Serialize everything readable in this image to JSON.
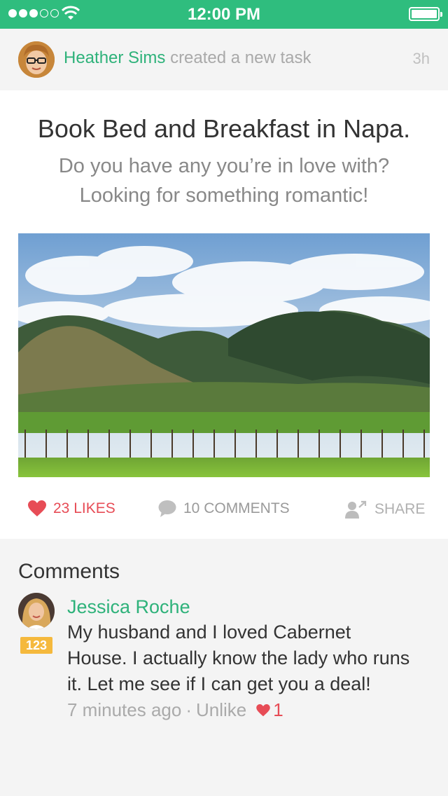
{
  "status_bar": {
    "time": "12:00 PM",
    "signal_bars_filled": 3,
    "signal_bars_total": 5
  },
  "activity": {
    "user_name": "Heather Sims",
    "action_text": "created a new task",
    "time_ago": "3h",
    "avatar_icon": "profile-photo"
  },
  "task": {
    "title": "Book Bed and Breakfast in Napa.",
    "description_line1": "Do you have any you’re in love with?",
    "description_line2": "Looking for something romantic!",
    "image": "napa-vineyard-mountains-photo"
  },
  "actions": {
    "likes_label": "23 LIKES",
    "comments_label": "10 COMMENTS",
    "share_label": "SHARE"
  },
  "comments": {
    "section_title": "Comments",
    "items": [
      {
        "author": "Jessica Roche",
        "badge": "123",
        "text_line1": "My husband and I loved Cabernet",
        "text_line2": "House. I actually know the lady who runs",
        "text_line3": "it. Let me see if I can get you a deal!",
        "time_ago": "7 minutes ago",
        "separator": "·",
        "unlike_label": "Unlike",
        "like_count": "1"
      }
    ]
  },
  "colors": {
    "accent_green": "#2fbd7e",
    "name_green": "#2eb27a",
    "like_red": "#e74c56",
    "badge_orange": "#f5b93d"
  }
}
